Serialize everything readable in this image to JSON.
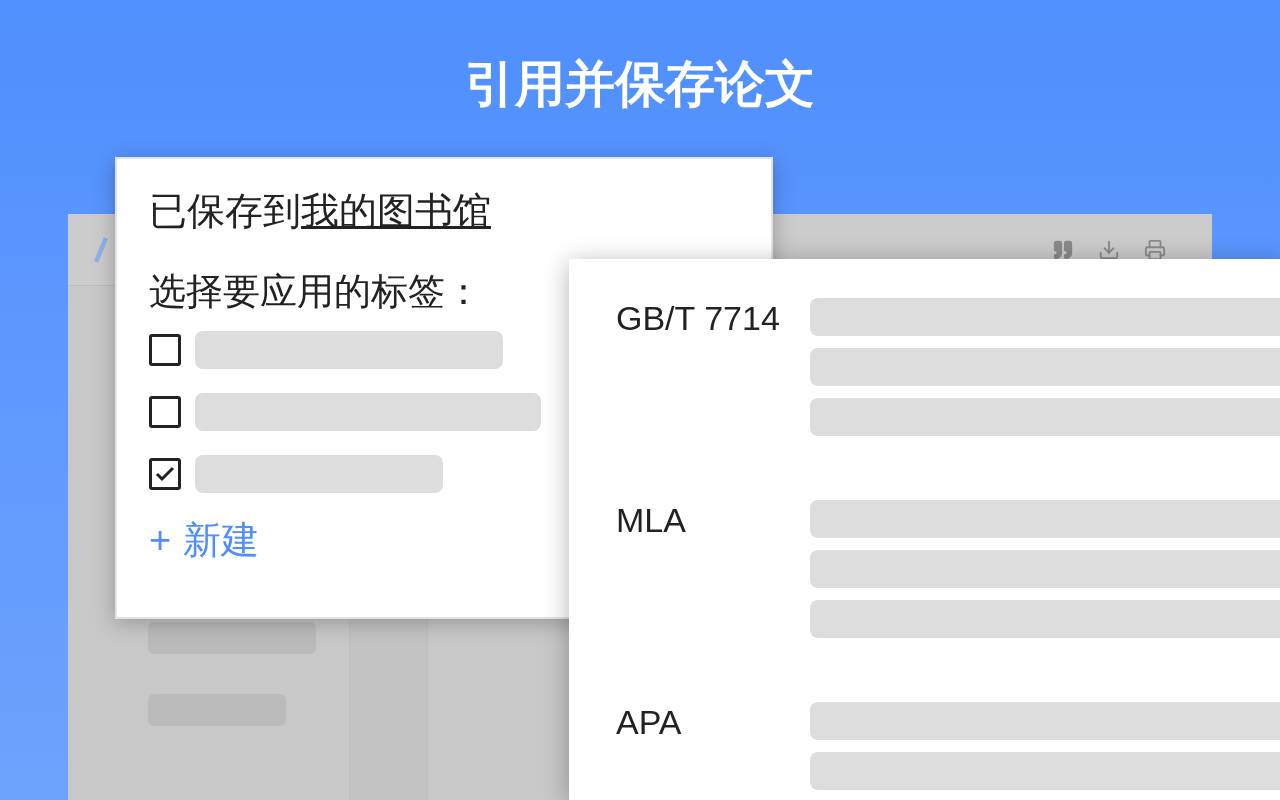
{
  "headline": "引用并保存论文",
  "save_popup": {
    "saved_prefix": "已保存到",
    "library_link": "我的图书馆",
    "tags_prompt": "选择要应用的标签：",
    "tags": [
      {
        "checked": false
      },
      {
        "checked": false
      },
      {
        "checked": true
      }
    ],
    "new_tag_button": {
      "icon": "+",
      "label": "新建"
    }
  },
  "cite_popup": {
    "styles": [
      {
        "name": "GB/T 7714"
      },
      {
        "name": "MLA"
      },
      {
        "name": "APA"
      }
    ]
  }
}
